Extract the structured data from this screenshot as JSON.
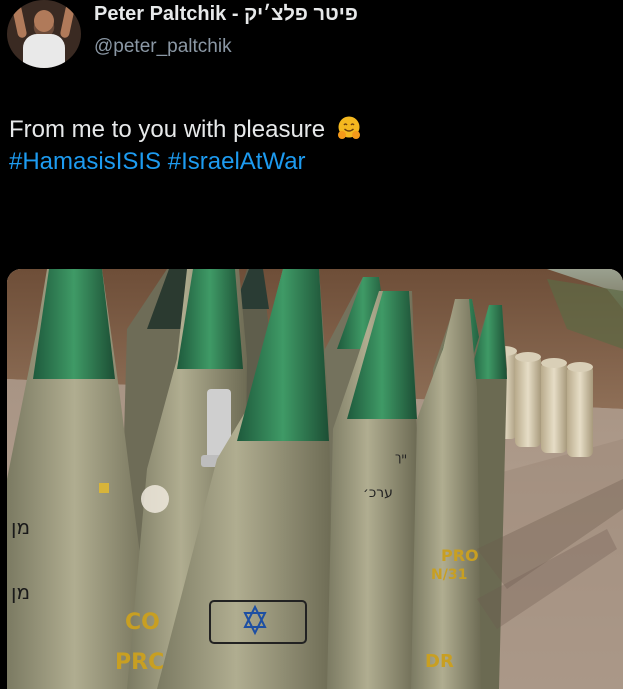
{
  "tweet": {
    "display_name": "Peter Paltchik - פיטר פלצ׳יק",
    "handle": "@peter_paltchik",
    "text_plain": "From me to you with pleasure",
    "emoji": "hugging-face-emoji",
    "hashtags": [
      "#HamasisISIS",
      "#IsraelAtWar"
    ]
  },
  "photo": {
    "shell_markings": {
      "left_a": "מן",
      "left_b": "מן",
      "center_a": "ערכ׳",
      "center_b": "ייך",
      "label_pro": "PRO",
      "label_prc": "PRC",
      "label_co": "CO",
      "label_isn": "N/31",
      "label_dr": "DR"
    }
  }
}
